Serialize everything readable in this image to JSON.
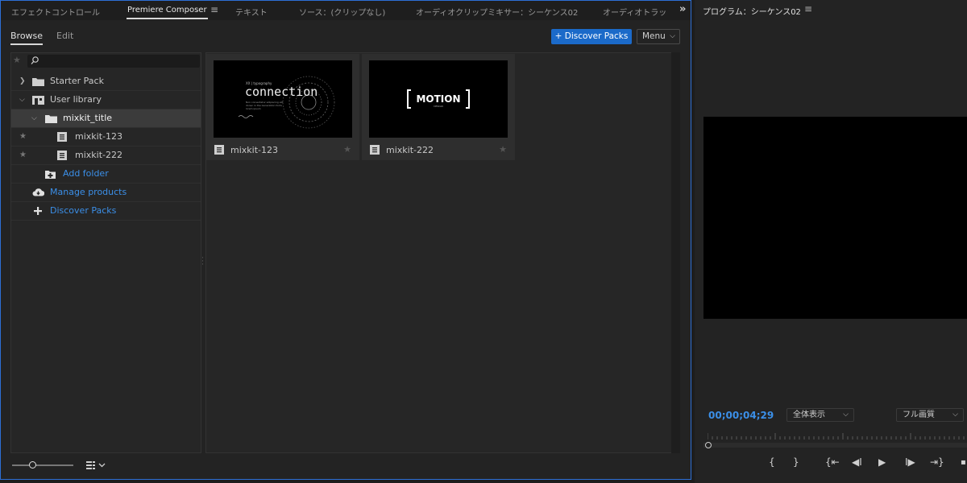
{
  "tabs": [
    {
      "label": "エフェクトコントロール"
    },
    {
      "label": "Premiere Composer"
    },
    {
      "label": "テキスト"
    },
    {
      "label": "ソース：(クリップなし)"
    },
    {
      "label": "オーディオクリップミキサー：シーケンス02"
    },
    {
      "label": "オーディオトラッ"
    }
  ],
  "subtabs": {
    "browse": "Browse",
    "edit": "Edit"
  },
  "toolbar": {
    "discover_label": "+ Discover Packs",
    "menu_label": "Menu"
  },
  "search": {
    "placeholder": ""
  },
  "tree": {
    "starter_pack": "Starter Pack",
    "user_library": "User library",
    "folder": "mixkit_title",
    "items": [
      {
        "label": "mixkit-123"
      },
      {
        "label": "mixkit-222"
      }
    ],
    "add_folder": "Add folder",
    "manage_products": "Manage products",
    "discover_packs": "Discover Packs"
  },
  "cards": [
    {
      "name": "mixkit-123",
      "thumb_header": "XX | typography",
      "thumb_title": "connection",
      "thumb_lines": [
        "Non consectetur adipiscing elit",
        "donec in the Generation fonts",
        "lorem ipsum"
      ]
    },
    {
      "name": "mixkit-222",
      "thumb_title": "MOTION",
      "thumb_sub": "DESIGN"
    }
  ],
  "program": {
    "title": "プログラム：シーケンス02",
    "timecode": "00;00;04;29",
    "zoom": "全体表示",
    "quality": "フル画質"
  },
  "colors": {
    "accent": "#1b6ac9",
    "link": "#3b8fe8",
    "panel": "#232323",
    "focus_border": "#2d6fd6"
  }
}
